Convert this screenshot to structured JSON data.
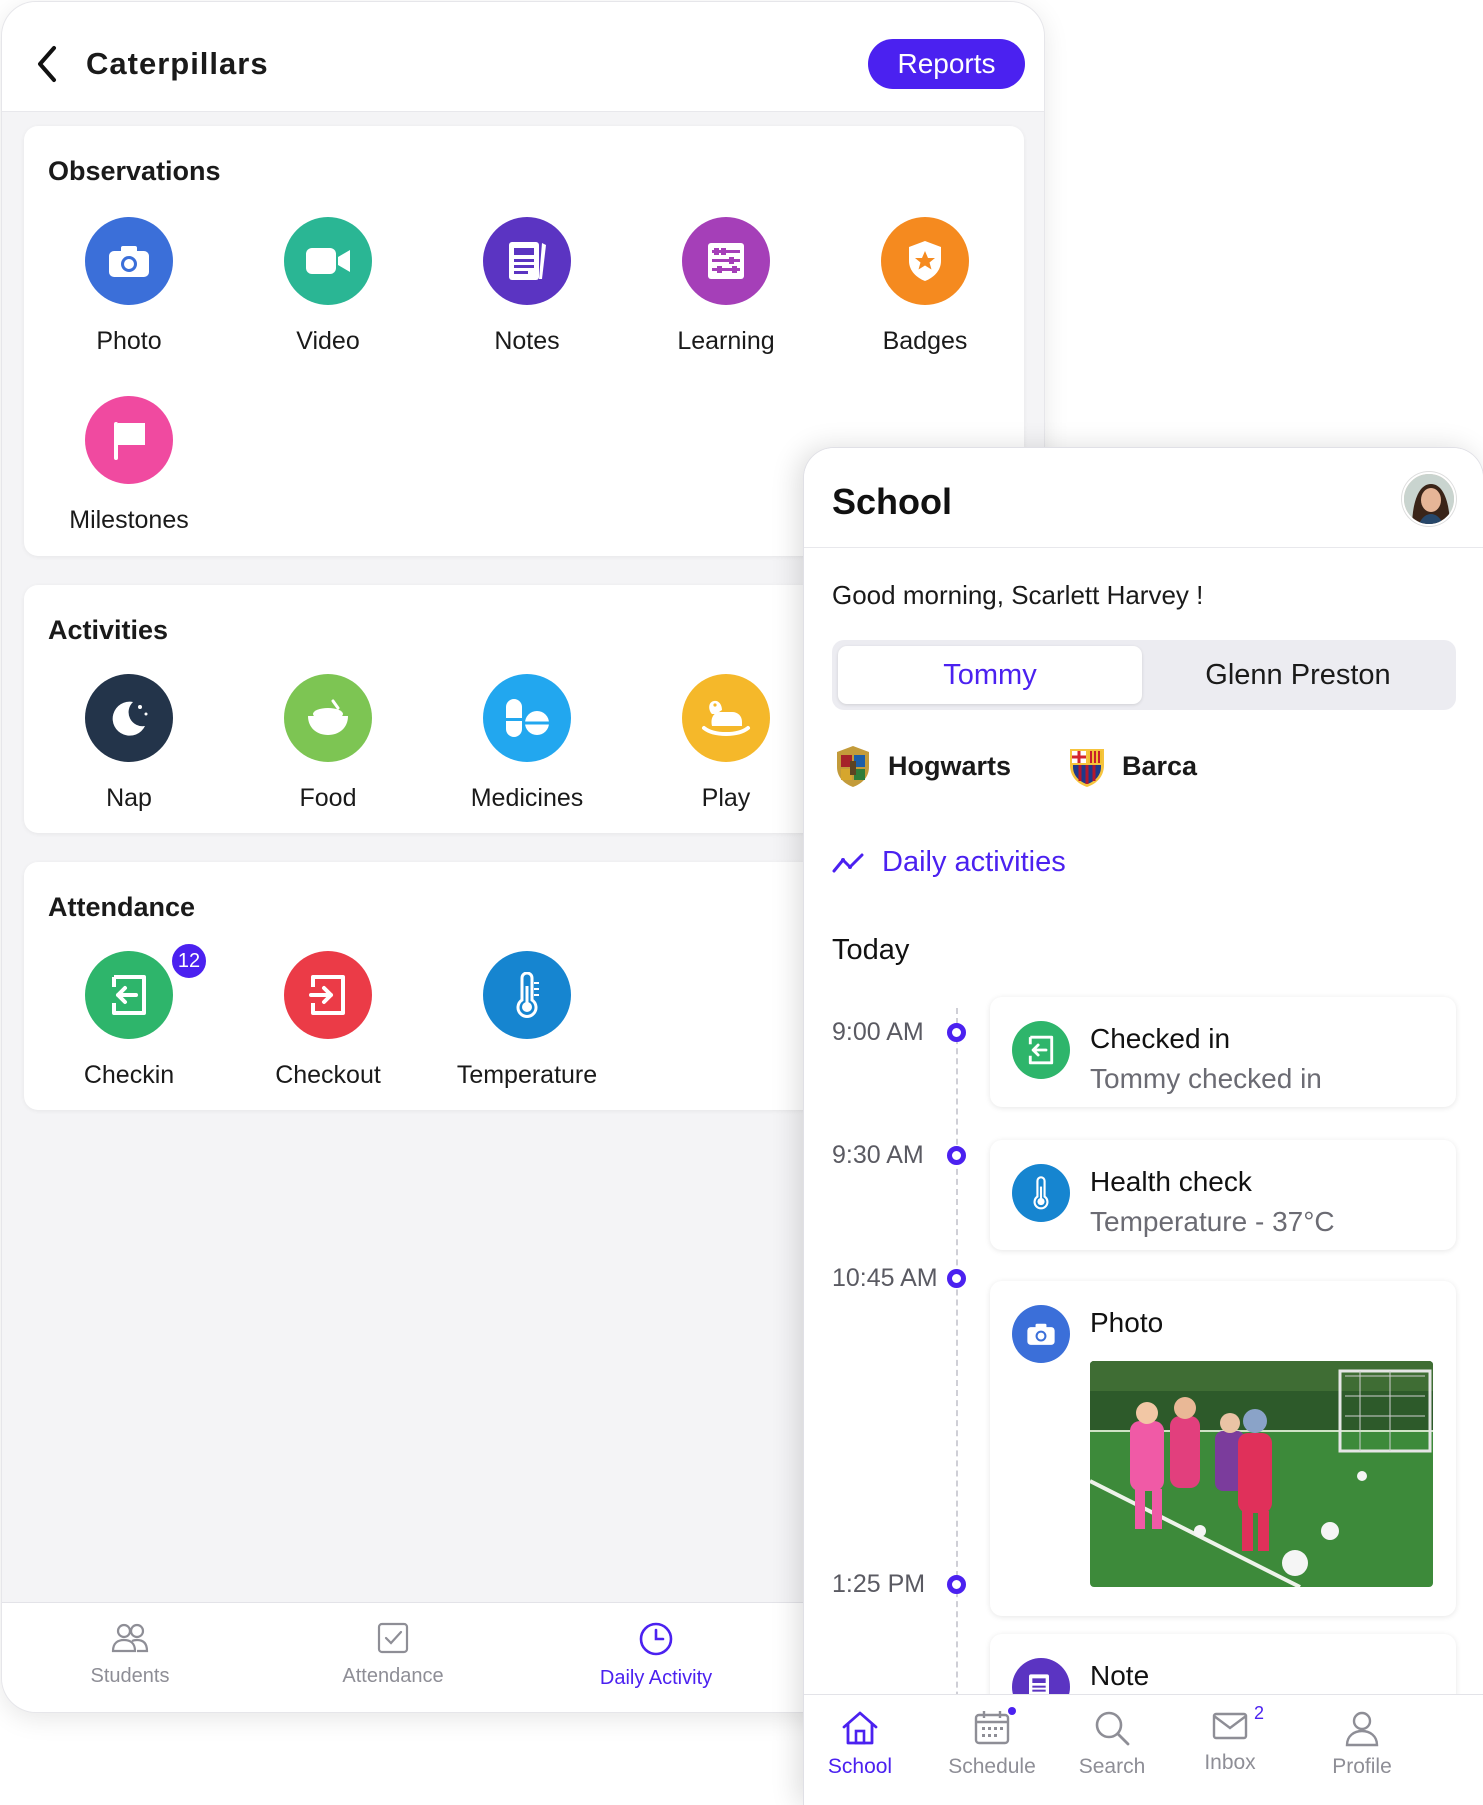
{
  "teacher": {
    "header": {
      "title": "Caterpillars",
      "reports_label": "Reports"
    },
    "observations": {
      "title": "Observations",
      "items": [
        {
          "label": "Photo",
          "icon": "camera-icon",
          "color": "#3b6fd9"
        },
        {
          "label": "Video",
          "icon": "video-icon",
          "color": "#2ab694"
        },
        {
          "label": "Notes",
          "icon": "notes-icon",
          "color": "#5b34c2"
        },
        {
          "label": "Learning",
          "icon": "abacus-icon",
          "color": "#a53fb8"
        },
        {
          "label": "Badges",
          "icon": "badge-icon",
          "color": "#f58a1f"
        },
        {
          "label": "Milestones",
          "icon": "flag-icon",
          "color": "#f04aa0"
        }
      ]
    },
    "activities": {
      "title": "Activities",
      "items": [
        {
          "label": "Nap",
          "icon": "moon-icon",
          "color": "#23344a"
        },
        {
          "label": "Food",
          "icon": "food-bowl-icon",
          "color": "#7dc553"
        },
        {
          "label": "Medicines",
          "icon": "pills-icon",
          "color": "#22a7ef"
        },
        {
          "label": "Play",
          "icon": "rocking-horse-icon",
          "color": "#f5b82a"
        }
      ]
    },
    "attendance": {
      "title": "Attendance",
      "items": [
        {
          "label": "Checkin",
          "icon": "checkin-icon",
          "color": "#2eb56b",
          "badge": "12"
        },
        {
          "label": "Checkout",
          "icon": "checkout-icon",
          "color": "#eb3b47"
        },
        {
          "label": "Temperature",
          "icon": "thermometer-icon",
          "color": "#1685d0"
        }
      ]
    },
    "tabs": [
      {
        "label": "Students",
        "icon": "students-icon",
        "active": false
      },
      {
        "label": "Attendance",
        "icon": "attendance-icon",
        "active": false
      },
      {
        "label": "Daily Activity",
        "icon": "clock-icon",
        "active": true
      }
    ]
  },
  "parent": {
    "header": {
      "title": "School"
    },
    "greeting": "Good morning, Scarlett Harvey !",
    "children": [
      {
        "label": "Tommy",
        "active": true
      },
      {
        "label": "Glenn Preston",
        "active": false
      }
    ],
    "schools": [
      {
        "label": "Hogwarts",
        "icon": "hogwarts-crest-icon"
      },
      {
        "label": "Barca",
        "icon": "barca-crest-icon"
      }
    ],
    "daily_link": "Daily activities",
    "today_label": "Today",
    "timeline": [
      {
        "time": "9:00 AM",
        "title": "Checked in",
        "subtitle": "Tommy checked in",
        "icon": "checkin-icon",
        "color": "#2eb56b"
      },
      {
        "time": "9:30 AM",
        "title": "Health check",
        "subtitle": "Temperature - 37°C",
        "icon": "thermometer-icon",
        "color": "#1685d0"
      },
      {
        "time": "10:45 AM",
        "title": "Photo",
        "icon": "camera-icon",
        "color": "#3b6fd9"
      },
      {
        "time": "1:25 PM",
        "title": "Note",
        "icon": "notes-icon",
        "color": "#5b34c2"
      }
    ],
    "tabs": [
      {
        "label": "School",
        "icon": "home-icon",
        "active": true
      },
      {
        "label": "Schedule",
        "icon": "calendar-icon",
        "active": false
      },
      {
        "label": "Search",
        "icon": "search-icon",
        "active": false
      },
      {
        "label": "Inbox",
        "icon": "mail-icon",
        "active": false,
        "badge": "2"
      },
      {
        "label": "Profile",
        "icon": "profile-icon",
        "active": false
      }
    ],
    "accent_color": "#4b21f0"
  }
}
